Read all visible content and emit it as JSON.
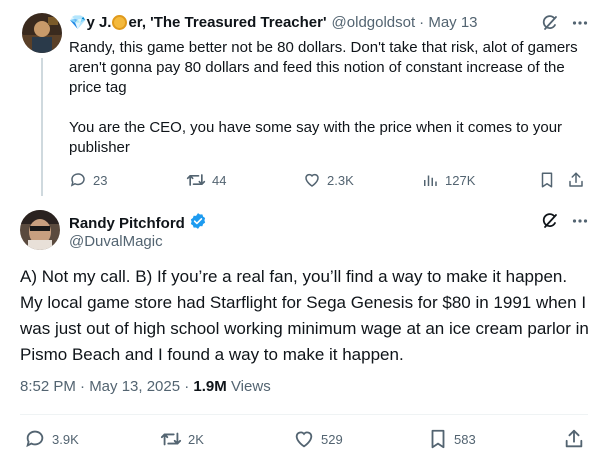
{
  "reply_tweet": {
    "author_emoji_prefix": "💎",
    "author_name_part1": "y J. ",
    "author_name_part2": "er, 'The Treasured Treacher'",
    "handle": "@oldgoldsot",
    "date": "· May 13",
    "paragraphs": [
      "Randy, this game better not be 80 dollars. Don't take that risk, alot of gamers aren't gonna pay 80 dollars and feed this notion of constant increase of the price tag",
      "You are the CEO, you have some say with the price when it comes to your publisher"
    ],
    "metrics": {
      "replies": "23",
      "reposts": "44",
      "likes": "2.3K",
      "views": "127K"
    }
  },
  "main_tweet": {
    "author_name": "Randy Pitchford",
    "handle": "@DuvalMagic",
    "text": "A) Not my call. B) If you’re a real fan, you’ll find a way to make it happen. My local game store had Starflight for Sega Genesis for $80 in 1991 when I was just out of high school working minimum wage at an ice cream parlor in Pismo Beach and I found a way to make it happen.",
    "timestamp": "8:52 PM · May 13, 2025 · ",
    "views_count": "1.9M",
    "views_label": " Views",
    "metrics": {
      "replies": "3.9K",
      "reposts": "2K",
      "likes": "529",
      "bookmarks": "583"
    }
  },
  "colors": {
    "text_primary": "#0f1419",
    "text_secondary": "#536471",
    "verified_blue": "#1d9bf0",
    "divider": "#eff3f4"
  }
}
